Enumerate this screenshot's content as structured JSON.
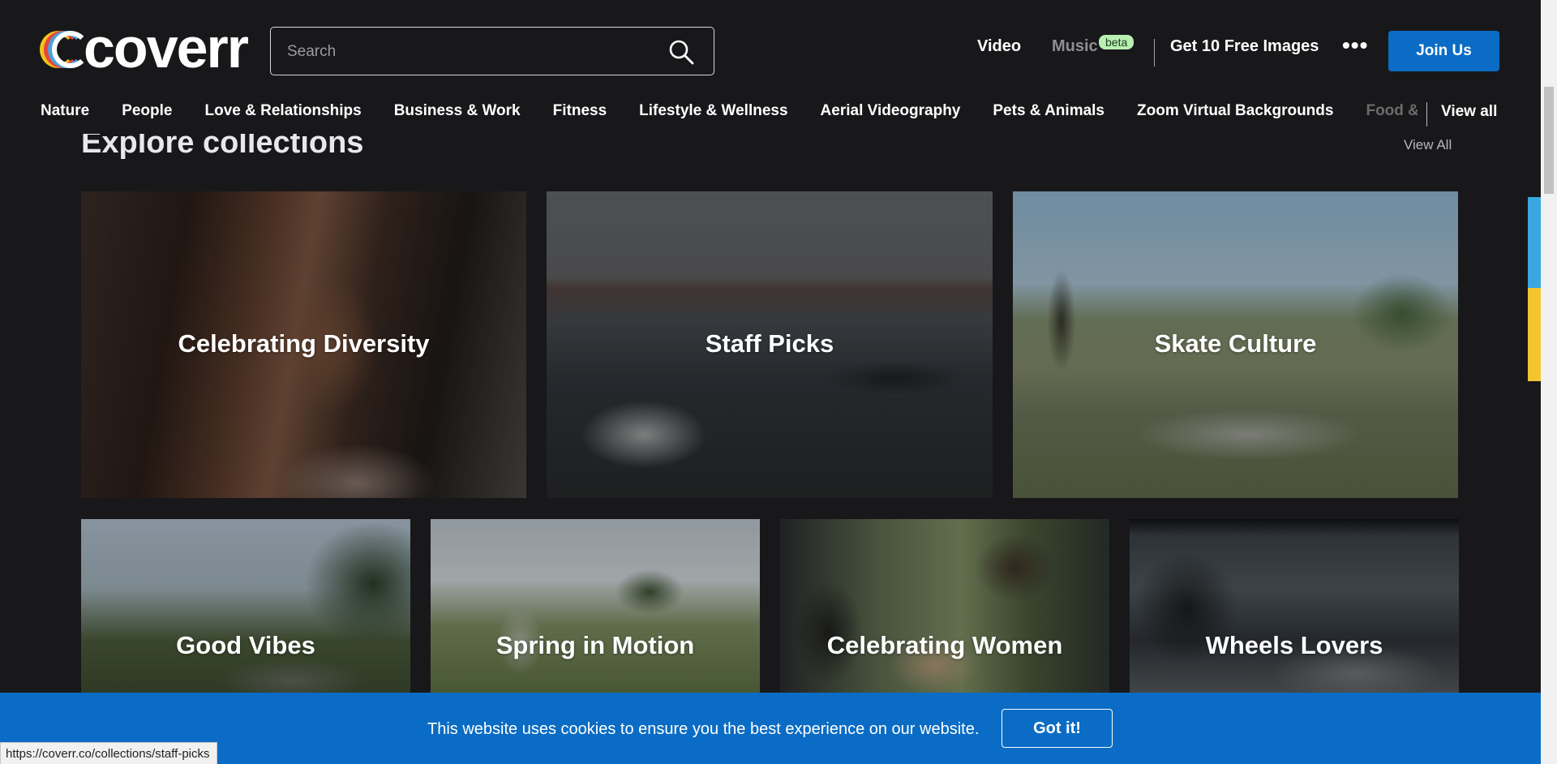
{
  "brand": {
    "logo_text": "coverr"
  },
  "search": {
    "placeholder": "Search"
  },
  "topnav": {
    "video": "Video",
    "music": "Music",
    "music_badge": "beta",
    "free_images": "Get 10 Free Images",
    "more": "•••",
    "join": "Join Us"
  },
  "categories": [
    "Nature",
    "People",
    "Love & Relationships",
    "Business & Work",
    "Fitness",
    "Lifestyle & Wellness",
    "Aerial Videography",
    "Pets & Animals",
    "Zoom Virtual Backgrounds",
    "Food &"
  ],
  "category_view_all": "View all",
  "section": {
    "title": "Explore collections",
    "view_all": "View All"
  },
  "collections": [
    {
      "label": "Celebrating Diversity"
    },
    {
      "label": "Staff Picks"
    },
    {
      "label": "Skate Culture"
    },
    {
      "label": "Good Vibes"
    },
    {
      "label": "Spring in Motion"
    },
    {
      "label": "Celebrating Women"
    },
    {
      "label": "Wheels Lovers"
    }
  ],
  "cookie": {
    "text": "This website uses cookies to ensure you the best experience on our website.",
    "button": "Got it!"
  },
  "status_bar": {
    "url": "https://coverr.co/collections/staff-picks"
  },
  "colors": {
    "background": "#18181b",
    "accent_blue": "#0a6cc4",
    "beta_badge": "#b9efb1"
  }
}
